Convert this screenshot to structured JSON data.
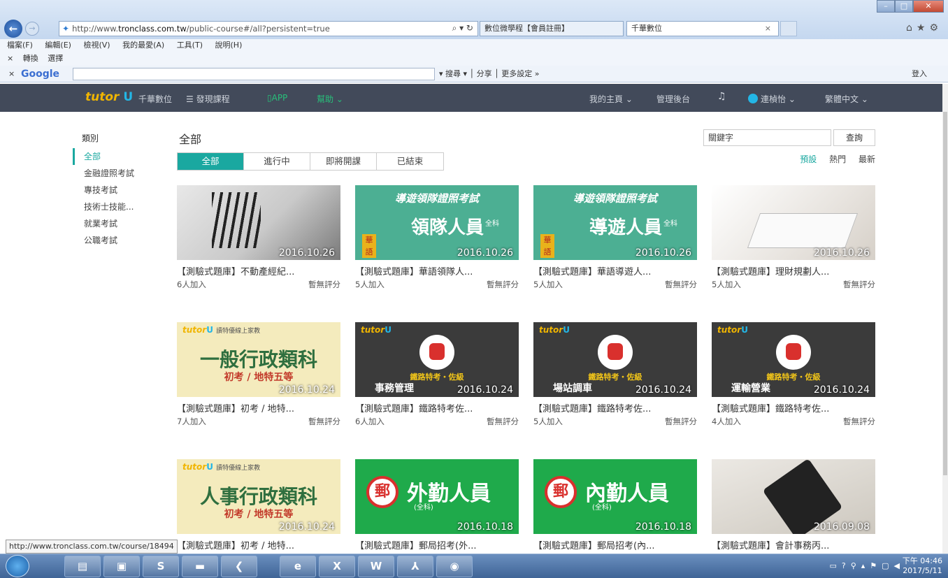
{
  "browser": {
    "url_prefix": "http://www.",
    "url_host": "tronclass.com.tw",
    "url_path": "/public-course#/all?persistent=true",
    "tabs": [
      "數位微學程【會員註冊】",
      "千華數位"
    ],
    "menu": [
      "檔案(F)",
      "編輯(E)",
      "檢視(V)",
      "我的最愛(A)",
      "工具(T)",
      "說明(H)"
    ],
    "fav": [
      "轉換",
      "選擇"
    ],
    "google": {
      "logo": "Google",
      "search": "搜尋",
      "share": "分享",
      "more": "更多設定 »",
      "login": "登入"
    }
  },
  "site": {
    "logo_text": "tutor",
    "logo_mark": "U",
    "brand": "千華數位",
    "nav": {
      "discover": "發現課程",
      "app": "APP",
      "help": "幫助",
      "home": "我的主頁",
      "admin": "管理後台",
      "user": "連楨怡",
      "lang": "繁體中文"
    }
  },
  "sidebar": {
    "title": "類別",
    "items": [
      "全部",
      "金融證照考試",
      "專技考試",
      "技術士技能...",
      "就業考試",
      "公職考試"
    ]
  },
  "main": {
    "title": "全部",
    "tabs": [
      "全部",
      "進行中",
      "即將開課",
      "已結束"
    ],
    "search_placeholder": "關鍵字",
    "search_button": "查詢",
    "sort": [
      "預設",
      "熱門",
      "最新"
    ]
  },
  "courses": [
    {
      "title": "【測驗式題庫】不動產經紀...",
      "joined": "6人加入",
      "rating": "暫無評分",
      "date": "2016.10.26"
    },
    {
      "title": "【測驗式題庫】華語領隊人...",
      "joined": "5人加入",
      "rating": "暫無評分",
      "date": "2016.10.26",
      "banner_top": "導遊領隊證照考試",
      "banner_main": "領隊人員",
      "badge": "華語",
      "tag": "全科"
    },
    {
      "title": "【測驗式題庫】華語導遊人...",
      "joined": "5人加入",
      "rating": "暫無評分",
      "date": "2016.10.26",
      "banner_top": "導遊領隊證照考試",
      "banner_main": "導遊人員",
      "badge": "華語",
      "tag": "全科"
    },
    {
      "title": "【測驗式題庫】理財規劃人...",
      "joined": "5人加入",
      "rating": "暫無評分",
      "date": "2016.10.26"
    },
    {
      "title": "【測驗式題庫】初考 / 地特...",
      "joined": "7人加入",
      "rating": "暫無評分",
      "date": "2016.10.24",
      "banner_top": "讀特優線上家教",
      "banner_main": "一般行政類科",
      "banner_sub": "初考 / 地特五等"
    },
    {
      "title": "【測驗式題庫】鐵路特考佐...",
      "joined": "6人加入",
      "rating": "暫無評分",
      "date": "2016.10.24",
      "banner_top": "鐵路特考・佐級",
      "banner_main": "事務管理"
    },
    {
      "title": "【測驗式題庫】鐵路特考佐...",
      "joined": "5人加入",
      "rating": "暫無評分",
      "date": "2016.10.24",
      "banner_top": "鐵路特考・佐級",
      "banner_main": "場站調車"
    },
    {
      "title": "【測驗式題庫】鐵路特考佐...",
      "joined": "4人加入",
      "rating": "暫無評分",
      "date": "2016.10.24",
      "banner_top": "鐵路特考・佐級",
      "banner_main": "運輸營業"
    },
    {
      "title": "【測驗式題庫】初考 / 地特...",
      "date": "2016.10.24",
      "banner_top": "讀特優線上家教",
      "banner_main": "人事行政類科",
      "banner_sub": "初考 / 地特五等"
    },
    {
      "title": "【測驗式題庫】郵局招考(外...",
      "date": "2016.10.18",
      "banner_main": "外勤人員",
      "banner_sub": "(全科)"
    },
    {
      "title": "【測驗式題庫】郵局招考(內...",
      "date": "2016.10.18",
      "banner_main": "內勤人員",
      "banner_sub": "(全科)"
    },
    {
      "title": "【測驗式題庫】會計事務丙...",
      "date": "2016.09.08"
    }
  ],
  "status_tip": "http://www.tronclass.com.tw/course/18494",
  "clock": {
    "time": "下午 04:46",
    "date": "2017/5/11"
  },
  "colors": {
    "accent": "#1aa8a0",
    "header": "#424a5a"
  }
}
